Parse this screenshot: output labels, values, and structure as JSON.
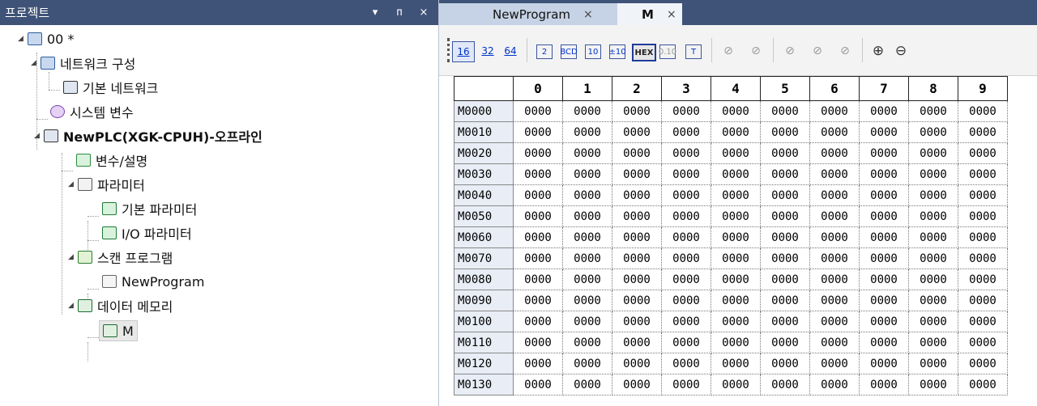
{
  "project_panel": {
    "title": "프로젝트",
    "buttons": {
      "dropdown": "▾",
      "pin": "ᴨ",
      "close": "×"
    },
    "tree": {
      "root": "00 *",
      "network_config": "네트워크 구성",
      "basic_network": "기본 네트워크",
      "system_vars": "시스템 변수",
      "plc": "NewPLC(XGK-CPUH)-오프라인",
      "var_desc": "변수/설명",
      "params": "파라미터",
      "basic_params": "기본 파라미터",
      "io_params": "I/O 파라미터",
      "scan_program": "스캔 프로그램",
      "new_program": "NewProgram",
      "data_memory": "데이터 메모리",
      "m": "M"
    }
  },
  "editor": {
    "tabs": [
      {
        "label": "NewProgram"
      },
      {
        "label": "M"
      }
    ],
    "toolbar": {
      "b16": "16",
      "b32": "32",
      "b64": "64",
      "bin": "2",
      "bcd": "BCD",
      "dec": "10",
      "sdec": "±10",
      "hex": "HEX",
      "real": "0.10",
      "text": "T"
    },
    "table": {
      "columns": [
        "0",
        "1",
        "2",
        "3",
        "4",
        "5",
        "6",
        "7",
        "8",
        "9"
      ],
      "rows": [
        {
          "addr": "M0000",
          "values": [
            "0000",
            "0000",
            "0000",
            "0000",
            "0000",
            "0000",
            "0000",
            "0000",
            "0000",
            "0000"
          ]
        },
        {
          "addr": "M0010",
          "values": [
            "0000",
            "0000",
            "0000",
            "0000",
            "0000",
            "0000",
            "0000",
            "0000",
            "0000",
            "0000"
          ]
        },
        {
          "addr": "M0020",
          "values": [
            "0000",
            "0000",
            "0000",
            "0000",
            "0000",
            "0000",
            "0000",
            "0000",
            "0000",
            "0000"
          ]
        },
        {
          "addr": "M0030",
          "values": [
            "0000",
            "0000",
            "0000",
            "0000",
            "0000",
            "0000",
            "0000",
            "0000",
            "0000",
            "0000"
          ]
        },
        {
          "addr": "M0040",
          "values": [
            "0000",
            "0000",
            "0000",
            "0000",
            "0000",
            "0000",
            "0000",
            "0000",
            "0000",
            "0000"
          ]
        },
        {
          "addr": "M0050",
          "values": [
            "0000",
            "0000",
            "0000",
            "0000",
            "0000",
            "0000",
            "0000",
            "0000",
            "0000",
            "0000"
          ]
        },
        {
          "addr": "M0060",
          "values": [
            "0000",
            "0000",
            "0000",
            "0000",
            "0000",
            "0000",
            "0000",
            "0000",
            "0000",
            "0000"
          ]
        },
        {
          "addr": "M0070",
          "values": [
            "0000",
            "0000",
            "0000",
            "0000",
            "0000",
            "0000",
            "0000",
            "0000",
            "0000",
            "0000"
          ]
        },
        {
          "addr": "M0080",
          "values": [
            "0000",
            "0000",
            "0000",
            "0000",
            "0000",
            "0000",
            "0000",
            "0000",
            "0000",
            "0000"
          ]
        },
        {
          "addr": "M0090",
          "values": [
            "0000",
            "0000",
            "0000",
            "0000",
            "0000",
            "0000",
            "0000",
            "0000",
            "0000",
            "0000"
          ]
        },
        {
          "addr": "M0100",
          "values": [
            "0000",
            "0000",
            "0000",
            "0000",
            "0000",
            "0000",
            "0000",
            "0000",
            "0000",
            "0000"
          ]
        },
        {
          "addr": "M0110",
          "values": [
            "0000",
            "0000",
            "0000",
            "0000",
            "0000",
            "0000",
            "0000",
            "0000",
            "0000",
            "0000"
          ]
        },
        {
          "addr": "M0120",
          "values": [
            "0000",
            "0000",
            "0000",
            "0000",
            "0000",
            "0000",
            "0000",
            "0000",
            "0000",
            "0000"
          ]
        },
        {
          "addr": "M0130",
          "values": [
            "0000",
            "0000",
            "0000",
            "0000",
            "0000",
            "0000",
            "0000",
            "0000",
            "0000",
            "0000"
          ]
        }
      ]
    }
  },
  "colors": {
    "header_bg": "#3f5378",
    "tab_inactive": "#c6d3e6",
    "address_bg": "#e8edf6"
  }
}
